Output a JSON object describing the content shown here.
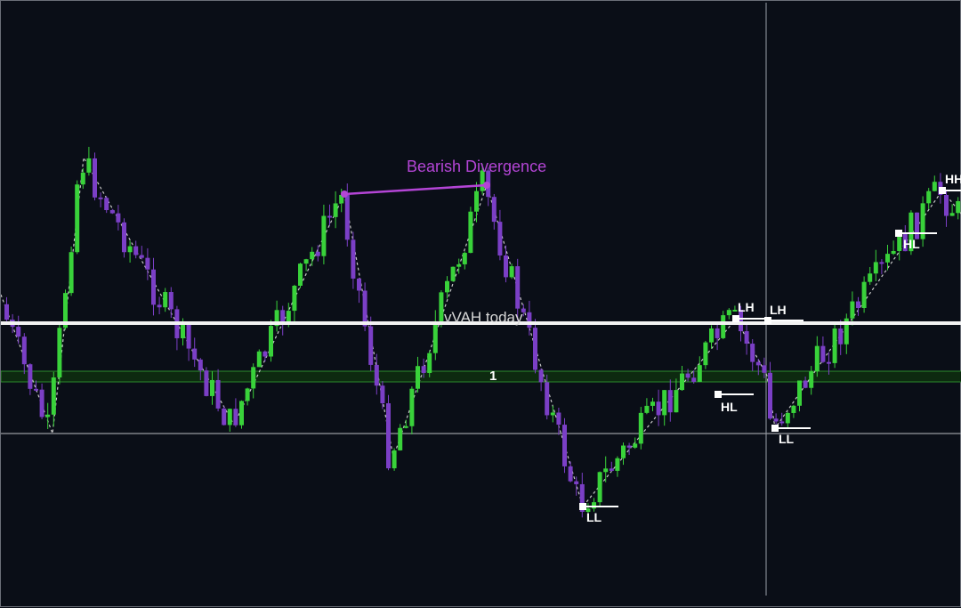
{
  "chart_data": {
    "type": "candlestick",
    "title": "",
    "colors": {
      "bull": "#39d23a",
      "bear": "#7b3fc6",
      "zigzag": "#c9c9c9",
      "divergence": "#b445d6",
      "level": "#f2f2f2",
      "zone": "#2b8a2b",
      "crosshair": "#9aa0a8"
    },
    "levels": {
      "vah_label": "vVAH today",
      "zone_label": "1"
    },
    "divergence": {
      "label": "Bearish Divergence"
    },
    "swings": [
      {
        "label": "LL"
      },
      {
        "label": "LH"
      },
      {
        "label": "HL"
      },
      {
        "label": "LH"
      },
      {
        "label": "LL"
      },
      {
        "label": "HL"
      },
      {
        "label": "HH"
      }
    ],
    "grid": false,
    "axes_visible": false
  }
}
